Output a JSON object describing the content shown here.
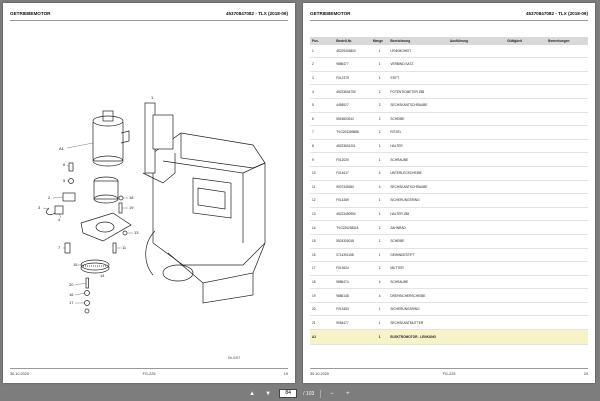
{
  "left_page": {
    "header_title": "GETRIEBEMOTOR",
    "header_model": "4537​0847082 - TLX (2018-09)",
    "diagram_label": "Db-5437",
    "callouts": [
      "A1",
      "1",
      "2",
      "3",
      "4",
      "5",
      "6",
      "7",
      "8",
      "9",
      "10",
      "11",
      "12",
      "13",
      "14",
      "15",
      "16",
      "17",
      "18",
      "19",
      "20",
      "21"
    ],
    "footer": {
      "date": "30.10.2020",
      "page_code": "FG-225",
      "page_no": "19"
    }
  },
  "right_page": {
    "header_title": "GETRIEBEMOTOR",
    "header_model": "45370847082 - TLX (2018-09)",
    "columns": [
      "Pos.",
      "Bestell-Nr.",
      "Menge",
      "Bezeichnung",
      "Ausführung",
      "Gültigkeit",
      "Bemerkungen"
    ],
    "rows": [
      {
        "pos": "1",
        "nr": "45229403800",
        "qty": "1",
        "desc": "LENKMOHEIT"
      },
      {
        "pos": "2",
        "nr": "9886477",
        "qty": "1",
        "desc": "VERBIND.SATZ"
      },
      {
        "pos": "3",
        "nr": "F012379",
        "qty": "1",
        "desc": "STIFT"
      },
      {
        "pos": "4",
        "nr": "45223604750",
        "qty": "1",
        "desc": "POTENTIOMETER Z88"
      },
      {
        "pos": "5",
        "nr": "4455927",
        "qty": "2",
        "desc": "SECHSKANTSCHRAUBE"
      },
      {
        "pos": "6",
        "nr": "5515803912",
        "qty": "2",
        "desc": "SCHEIBE"
      },
      {
        "pos": "7",
        "nr": "TVG203359888",
        "qty": "1",
        "desc": "RITZEL"
      },
      {
        "pos": "8",
        "nr": "45223601201",
        "qty": "1",
        "desc": "HALTER"
      },
      {
        "pos": "9",
        "nr": "F012020",
        "qty": "1",
        "desc": "SCHRAUBE"
      },
      {
        "pos": "10",
        "nr": "F014617",
        "qty": "4",
        "desc": "UNTERLEGSCHEIBE"
      },
      {
        "pos": "11",
        "nr": "9007345350",
        "qty": "4",
        "desc": "SECHSKANTSCHRAUBE"
      },
      {
        "pos": "12",
        "nr": "F014269",
        "qty": "1",
        "desc": "SICHERUNGSRING"
      },
      {
        "pos": "13",
        "nr": "45223450950",
        "qty": "1",
        "desc": "HALTER Z88"
      },
      {
        "pos": "14",
        "nr": "TVG226258118",
        "qty": "1",
        "desc": "ZAHNRAD"
      },
      {
        "pos": "15",
        "nr": "5524300018",
        "qty": "1",
        "desc": "SCHEIBE"
      },
      {
        "pos": "16",
        "nr": "0714391158",
        "qty": "1",
        "desc": "GEWINDESTIFT"
      },
      {
        "pos": "17",
        "nr": "F013624",
        "qty": "1",
        "desc": "MUTTER"
      },
      {
        "pos": "18",
        "nr": "9886474",
        "qty": "4",
        "desc": "SCHRAUBE"
      },
      {
        "pos": "19",
        "nr": "9886148",
        "qty": "4",
        "desc": "DREHSICHERSCHEIBE"
      },
      {
        "pos": "20",
        "nr": "F013453",
        "qty": "1",
        "desc": "SICHERUNGSRING"
      },
      {
        "pos": "21",
        "nr": "9064477",
        "qty": "1",
        "desc": "SECHSKANTMUTTER"
      },
      {
        "pos": "A1",
        "nr": "",
        "qty": "1",
        "desc": "ELEKTROMOTOR - LENKUNG",
        "highlight": true
      }
    ],
    "footer": {
      "date": "30.10.2020",
      "page_code": "FG-225",
      "page_no": "20"
    }
  },
  "toolbar": {
    "current_page": "84",
    "total_pages": "/ 103",
    "prev_icon": "▲",
    "next_icon": "▼",
    "zoom_out_icon": "−",
    "zoom_in_icon": "+"
  }
}
